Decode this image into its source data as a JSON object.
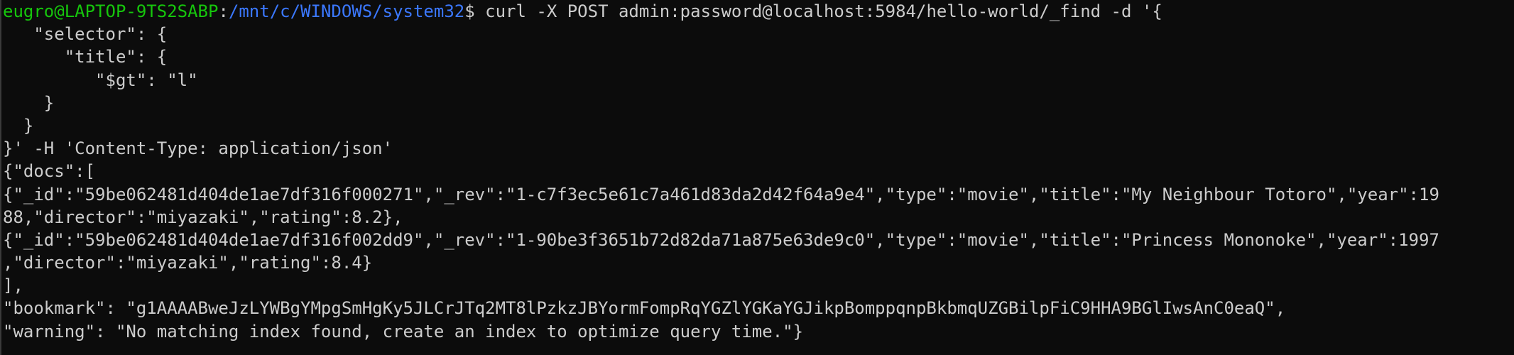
{
  "terminal": {
    "prompt": {
      "user_host": "eugro@LAPTOP-9TS2SABP",
      "separator": ":",
      "path": "/mnt/c/WINDOWS/system32",
      "symbol": "$"
    },
    "command": " curl -X POST admin:password@localhost:5984/hello-world/_find -d '{",
    "lines": [
      "   \"selector\": {",
      "      \"title\": {",
      "         \"$gt\": \"l\"",
      "    }",
      "  }",
      "}' -H 'Content-Type: application/json'",
      "{\"docs\":[",
      "{\"_id\":\"59be062481d404de1ae7df316f000271\",\"_rev\":\"1-c7f3ec5e61c7a461d83da2d42f64a9e4\",\"type\":\"movie\",\"title\":\"My Neighbour Totoro\",\"year\":19",
      "88,\"director\":\"miyazaki\",\"rating\":8.2},",
      "{\"_id\":\"59be062481d404de1ae7df316f002dd9\",\"_rev\":\"1-90be3f3651b72d82da71a875e63de9c0\",\"type\":\"movie\",\"title\":\"Princess Mononoke\",\"year\":1997",
      ",\"director\":\"miyazaki\",\"rating\":8.4}",
      "],",
      "\"bookmark\": \"g1AAAABweJzLYWBgYMpgSmHgKy5JLCrJTq2MT8lPzkzJBYormFompRqYGZlYGKaYGJikpBomppqnpBkbmqUZGBilpFiC9HHA9BGlIwsAnC0eaQ\",",
      "\"warning\": \"No matching index found, create an index to optimize query time.\"}"
    ],
    "colors": {
      "background": "#0c0c0c",
      "text": "#cccccc",
      "prompt_user": "#16c60c",
      "prompt_path": "#3b78ff"
    }
  }
}
